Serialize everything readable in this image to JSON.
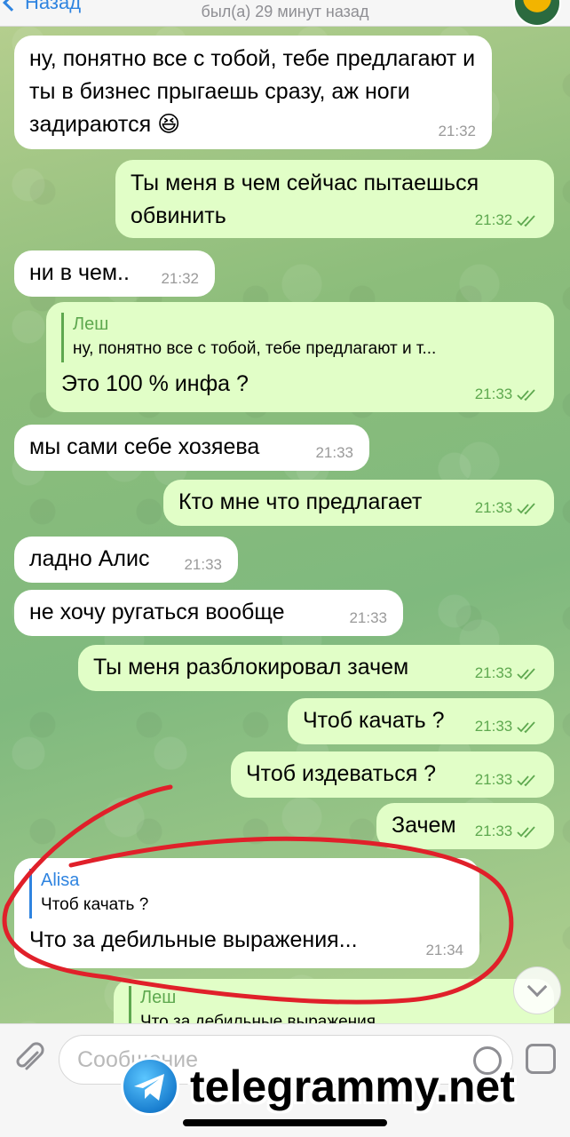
{
  "header": {
    "back_label": "Назад",
    "status": "был(а) 29 минут назад"
  },
  "messages": [
    {
      "dir": "in",
      "text": "ну, понятно все с тобой, тебе предлагают и ты в бизнес прыгаешь сразу, аж ноги задираются 😆",
      "time": "21:32"
    },
    {
      "dir": "out",
      "text": "Ты меня в чем сейчас пытаешься обвинить",
      "time": "21:32",
      "read": true
    },
    {
      "dir": "in",
      "text": "ни в чем..",
      "time": "21:32"
    },
    {
      "dir": "out",
      "reply_name": "Леш",
      "reply_text": "ну, понятно все с тобой, тебе предлагают и т...",
      "text": "Это 100 % инфа ?",
      "time": "21:33",
      "read": true
    },
    {
      "dir": "in",
      "text": "мы сами себе хозяева",
      "time": "21:33"
    },
    {
      "dir": "out",
      "text": "Кто мне что предлагает",
      "time": "21:33",
      "read": true
    },
    {
      "dir": "in",
      "text": "ладно Алис",
      "time": "21:33"
    },
    {
      "dir": "in",
      "text": "не хочу ругаться вообще",
      "time": "21:33"
    },
    {
      "dir": "out",
      "text": "Ты меня разблокировал зачем",
      "time": "21:33",
      "read": true
    },
    {
      "dir": "out",
      "text": "Чтоб качать ?",
      "time": "21:33",
      "read": true
    },
    {
      "dir": "out",
      "text": "Чтоб издеваться ?",
      "time": "21:33",
      "read": true
    },
    {
      "dir": "out",
      "text": "Зачем",
      "time": "21:33",
      "read": true
    },
    {
      "dir": "in",
      "reply_name": "Alisa",
      "reply_text": "Чтоб качать ?",
      "text": "Что за дебильные выражения...",
      "time": "21:34"
    },
    {
      "dir": "out",
      "reply_name": "Леш",
      "reply_text": "Что за дебильные выражения",
      "text": "",
      "time": ""
    }
  ],
  "input": {
    "placeholder": "Сообщение"
  },
  "watermark": "telegrammy.net",
  "colors": {
    "incoming_bubble": "#ffffff",
    "outgoing_bubble": "#e1fec7",
    "accent": "#2f84e0",
    "read_check": "#5ea84f",
    "annotation": "#e0202a"
  }
}
